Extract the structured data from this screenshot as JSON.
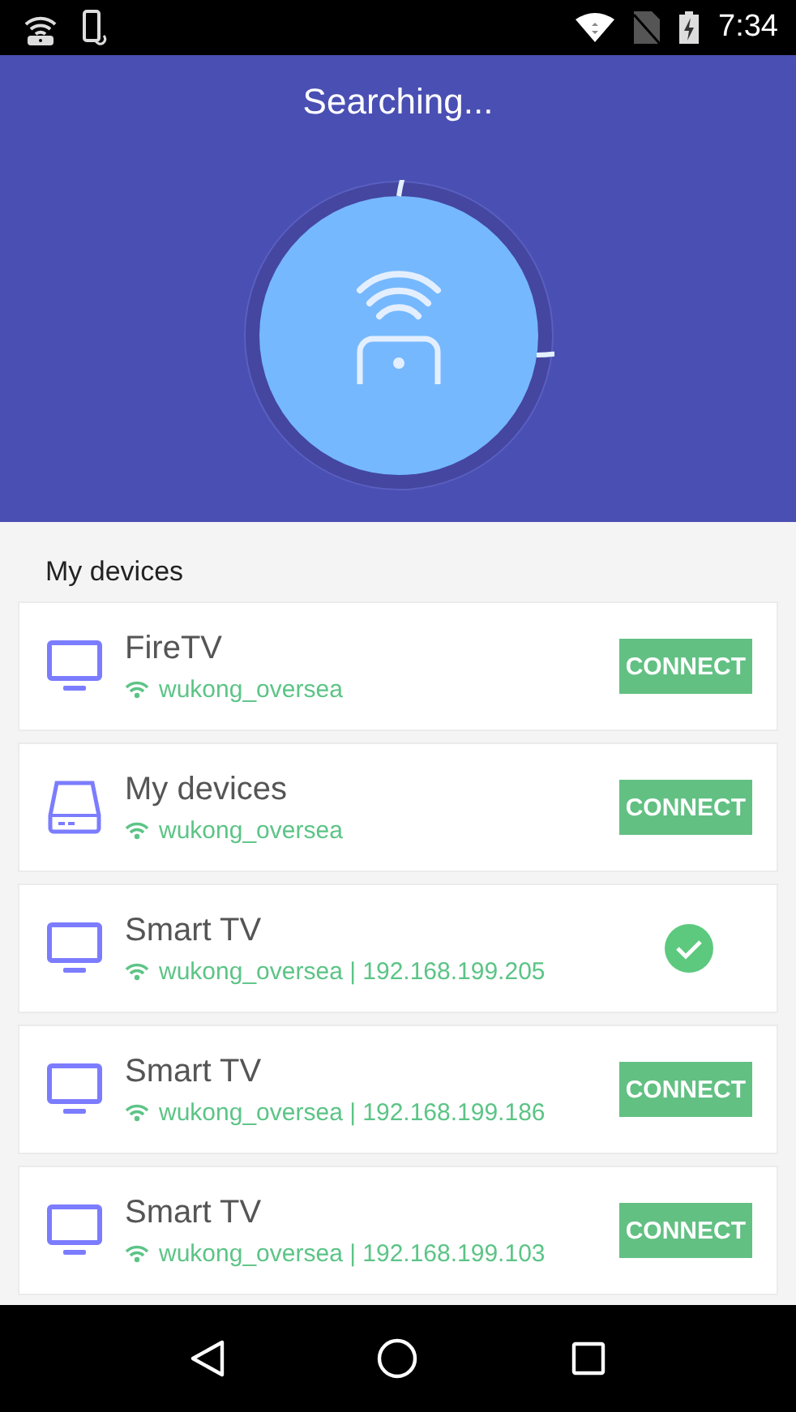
{
  "status_bar": {
    "time": "7:34"
  },
  "header": {
    "title": "Searching..."
  },
  "section_title": "My devices",
  "devices": [
    {
      "kind": "tv",
      "name": "FireTV",
      "network": "wukong_oversea",
      "connected": false,
      "button": "CONNECT"
    },
    {
      "kind": "drive",
      "name": "My devices",
      "network": "wukong_oversea",
      "connected": false,
      "button": "CONNECT"
    },
    {
      "kind": "tv",
      "name": "Smart TV",
      "network": "wukong_oversea | 192.168.199.205",
      "connected": true
    },
    {
      "kind": "tv",
      "name": "Smart TV",
      "network": "wukong_oversea | 192.168.199.186",
      "connected": false,
      "button": "CONNECT"
    },
    {
      "kind": "tv",
      "name": "Smart TV",
      "network": "wukong_oversea | 192.168.199.103",
      "connected": false,
      "button": "CONNECT"
    }
  ]
}
